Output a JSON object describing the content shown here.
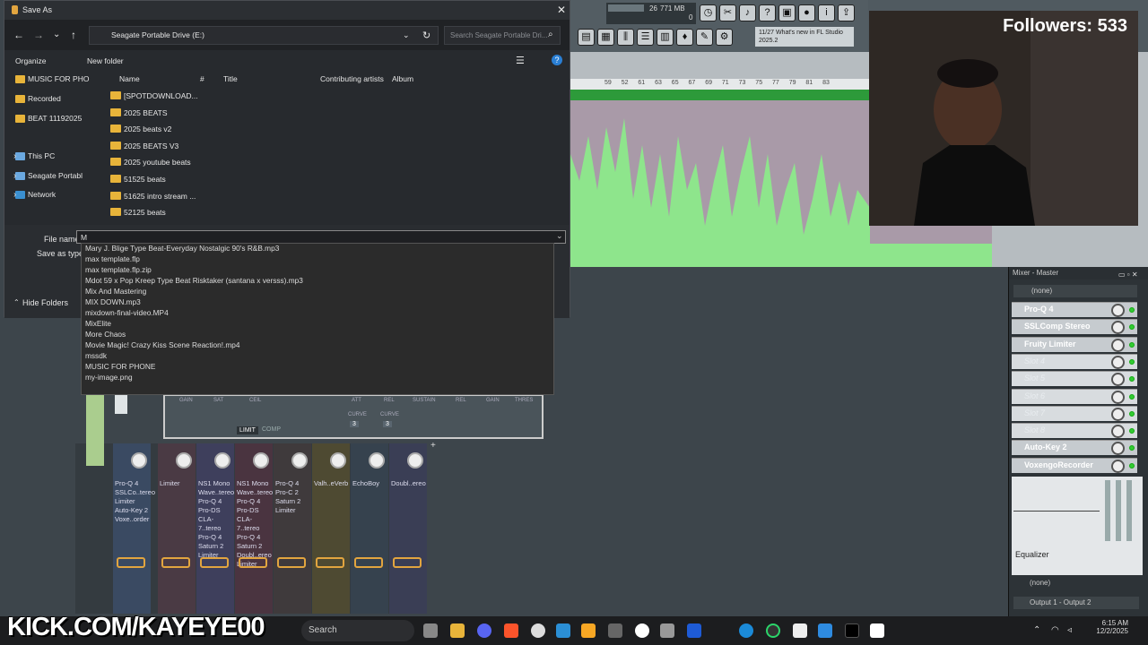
{
  "dialog": {
    "title": "Save As",
    "address": "Seagate Portable Drive (E:)",
    "search_placeholder": "Search Seagate Portable Dri...",
    "organize": "Organize",
    "new_folder": "New folder",
    "sidebar": [
      {
        "label": "MUSIC FOR PHO"
      },
      {
        "label": "Recorded"
      },
      {
        "label": "BEAT 11192025"
      },
      {
        "label": "This PC"
      },
      {
        "label": "Seagate Portabl"
      },
      {
        "label": "Network"
      }
    ],
    "columns": [
      "Name",
      "#",
      "Title",
      "Contributing artists",
      "Album"
    ],
    "files": [
      "[SPOTDOWNLOAD...",
      "2025 BEATS",
      "2025 beats v2",
      "2025 BEATS V3",
      "2025 youtube beats",
      "51525 beats",
      "51625 intro stream ...",
      "52125 beats"
    ],
    "file_name_label": "File name:",
    "file_name_value": "M",
    "save_as_type_label": "Save as type:",
    "hide_folders": "Hide Folders",
    "autocomplete": [
      "Mary J. Blige Type Beat-Everyday  Nostalgic 90's R&B.mp3",
      "max template.flp",
      "max template.flp.zip",
      "Mdot 59 x Pop Kreep Type Beat Risktaker (santana x versss).mp3",
      "Mix And Mastering",
      "MIX DOWN.mp3",
      "mixdown-final-video.MP4",
      "MixElite",
      "More Chaos",
      "Movie Magic! Crazy Kiss Scene Reaction!.mp4",
      "mssdk",
      "MUSIC FOR PHONE",
      "my-image.png"
    ]
  },
  "fl": {
    "cpu_top": "26",
    "memory": "771 MB",
    "cpu_bottom": "0",
    "whats_new_date": "11/27",
    "whats_new": "What's new in FL Studio 2025.2",
    "ruler": [
      "59",
      "52",
      "61",
      "63",
      "65",
      "67",
      "69",
      "71",
      "73",
      "75",
      "77",
      "79",
      "81",
      "83"
    ],
    "mixer_title": "Mixer - Master",
    "input": "(none)",
    "slots": [
      "Pro-Q 4",
      "SSLComp Stereo",
      "Fruity Limiter",
      "Slot 4",
      "Slot 5",
      "Slot 6",
      "Slot 7",
      "Slot 8",
      "Auto-Key 2",
      "VoxengoRecorder"
    ],
    "eq_label": "Equalizer",
    "output_none": "(none)",
    "output": "Output 1 - Output 2",
    "limiter": {
      "labels": [
        "GAIN",
        "SAT",
        "CEIL",
        "ATT",
        "REL",
        "SUSTAIN",
        "REL",
        "GAIN",
        "THRES"
      ],
      "curve": "CURVE",
      "curve1": "3",
      "curve2": "3",
      "tab_limit": "LIMIT",
      "tab_comp": "COMP"
    },
    "strips": [
      [
        "Pro-Q 4",
        "SSLCo..tereo",
        "Limiter",
        "Auto-Key 2",
        "Voxe..order"
      ],
      [
        "Limiter"
      ],
      [
        "NS1 Mono",
        "Wave..tereo",
        "Pro-Q 4",
        "Pro-DS",
        "CLA-7..tereo",
        "Pro-Q 4",
        "Saturn 2",
        "Limiter"
      ],
      [
        "NS1 Mono",
        "Wave..tereo",
        "Pro-Q 4",
        "Pro-DS",
        "CLA-7..tereo",
        "Pro-Q 4",
        "Saturn 2",
        "Doubl..ereo",
        "Limiter"
      ],
      [
        "Pro-Q 4",
        "Pro-C 2",
        "Saturn 2",
        "Limiter"
      ],
      [
        "Valh..eVerb"
      ],
      [
        "EchoBoy"
      ],
      [
        "Doubl..ereo"
      ]
    ]
  },
  "stream": {
    "followers": "Followers: 533",
    "kick": "KICK.COM/KAYEYE00"
  },
  "taskbar": {
    "search": "Search",
    "time": "6:15 AM",
    "date": "12/2/2025"
  }
}
